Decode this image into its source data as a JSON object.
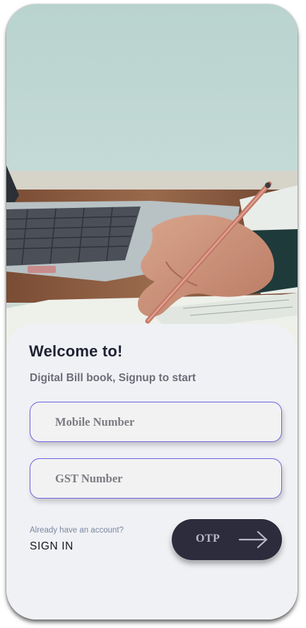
{
  "hero": {
    "image_icon": "desk-laptop-writing-photo"
  },
  "card": {
    "title": "Welcome to!",
    "subtitle": "Digital Bill book, Signup to start"
  },
  "form": {
    "mobile_placeholder": "Mobile Number",
    "mobile_value": "",
    "gst_placeholder": "GST Number",
    "gst_value": ""
  },
  "footer": {
    "already_text": "Already have an account?",
    "signin_label": "SIGN IN",
    "otp_label": "OTP",
    "otp_icon": "arrow-right-icon"
  },
  "colors": {
    "accent_border": "#6e63e0",
    "button_bg": "#2c2c3d",
    "card_bg": "#f0f1f5"
  }
}
